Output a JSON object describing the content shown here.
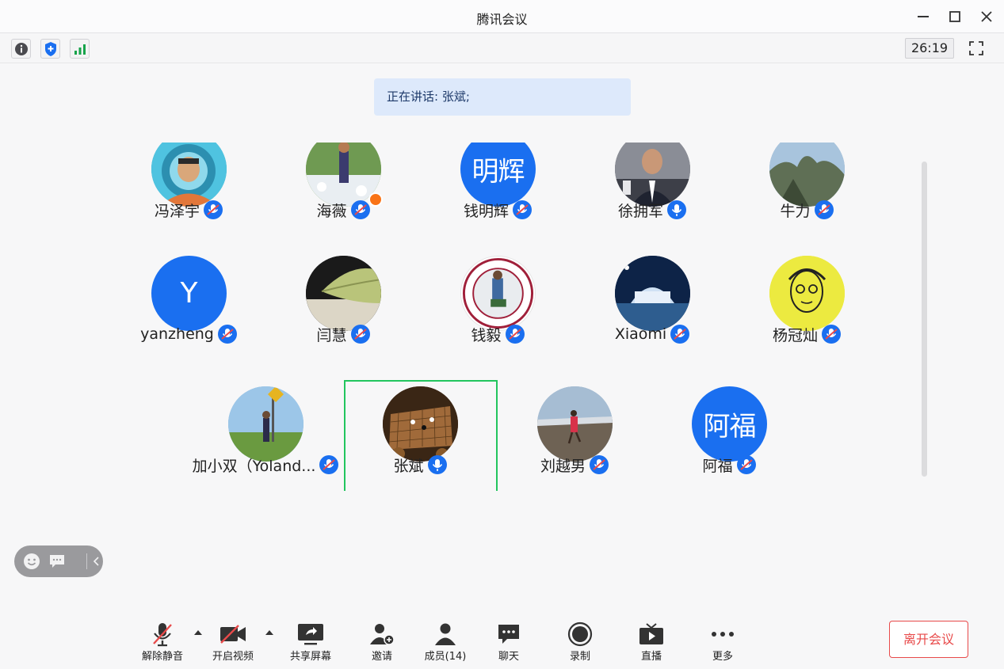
{
  "window": {
    "title": "腾讯会议"
  },
  "infobar": {
    "timer": "26:19"
  },
  "speaking": {
    "label": "正在讲话: ",
    "name": "张斌;"
  },
  "participants": [
    {
      "name": "冯泽宇",
      "avatar": "photo-astronaut"
    },
    {
      "name": "海薇",
      "avatar": "photo-garden",
      "host": true
    },
    {
      "name": "钱明辉",
      "avatar": "text",
      "initials": "明辉"
    },
    {
      "name": "徐拥军",
      "avatar": "photo-suit"
    },
    {
      "name": "牛力",
      "avatar": "photo-mountain"
    },
    {
      "name": "yanzheng",
      "avatar": "letter",
      "initials": "Y"
    },
    {
      "name": "闫慧",
      "avatar": "photo-leaf"
    },
    {
      "name": "钱毅",
      "avatar": "photo-seal"
    },
    {
      "name": "Xiaomi",
      "avatar": "photo-building"
    },
    {
      "name": "杨冠灿",
      "avatar": "photo-sketch"
    },
    {
      "name": "加小双（Yoland...",
      "avatar": "photo-field"
    },
    {
      "name": "张斌",
      "avatar": "photo-board",
      "active": true
    },
    {
      "name": "刘越男",
      "avatar": "photo-beach"
    },
    {
      "name": "阿福",
      "avatar": "text",
      "initials": "阿福"
    }
  ],
  "toolbar": {
    "unmute": "解除静音",
    "video": "开启视频",
    "share": "共享屏幕",
    "invite": "邀请",
    "members": "成员(14)",
    "chat": "聊天",
    "record": "录制",
    "live": "直播",
    "more": "更多",
    "leave": "离开会议"
  },
  "colors": {
    "accent": "#1a6ff0",
    "active_border": "#22c55e",
    "leave": "#e84a4a",
    "speaking_bg": "#dde9fb"
  },
  "icons": {
    "info": "info-icon",
    "shield": "shield-icon",
    "signal": "signal-icon",
    "fullscreen": "fullscreen-icon",
    "emoji": "emoji-icon",
    "message": "message-icon",
    "collapse": "chevron-left-icon"
  }
}
